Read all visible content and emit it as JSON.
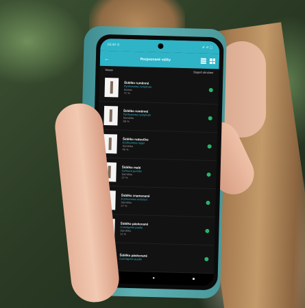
{
  "app": {
    "title": "Rozpoznané vážky",
    "column_name": "Název",
    "column_confidence": "Stupeň ohrožení"
  },
  "status": {
    "time": "16:44 ⊙",
    "indicators": "⊿ ⊿ ▢"
  },
  "icons": {
    "back": "back-arrow-icon",
    "list": "list-icon",
    "grid": "grid-icon"
  },
  "results": [
    {
      "name": "Šidélko ruměnné",
      "latin": "Pyrrhosoma nymphula",
      "sex": "Samec",
      "pct": "71 %"
    },
    {
      "name": "Šidélko ruměnné",
      "latin": "Pyrrhosoma nymphula",
      "sex": "Samička",
      "pct": "68 %"
    },
    {
      "name": "Šidélko rudoočko",
      "latin": "Erythromma najas",
      "sex": "Samička",
      "pct": "45 %"
    },
    {
      "name": "Šidélko malé",
      "latin": "Ischnura pumilio",
      "sex": "Samička",
      "pct": "37 %"
    },
    {
      "name": "Šidélko znamenané",
      "latin": "Erythromma viridulum",
      "sex": "Samička",
      "pct": "27 %"
    },
    {
      "name": "Šidélko páskované",
      "latin": "Coenagrion puella",
      "sex": "Samička",
      "pct": "11 %"
    },
    {
      "name": "Šidélko páskované",
      "latin": "Coenagrion puella",
      "sex": "",
      "pct": ""
    }
  ],
  "navbar": {
    "back": "◂",
    "home": "●",
    "recents": "■"
  }
}
